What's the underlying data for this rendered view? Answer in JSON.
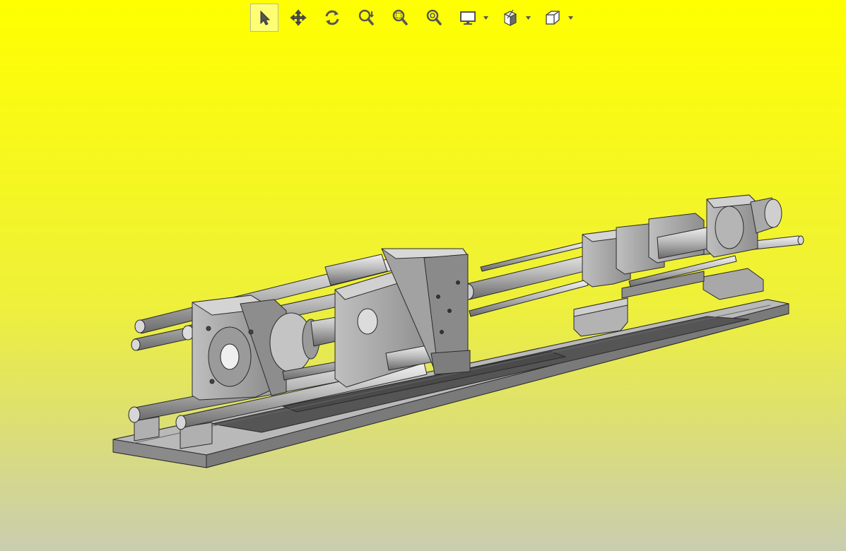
{
  "viewport": {
    "background_top": "#ffff00",
    "background_bottom": "#c9cdb0"
  },
  "toolbar": {
    "tools": [
      {
        "id": "select",
        "icon": "cursor-arrow-icon",
        "active": true
      },
      {
        "id": "pan",
        "icon": "pan-arrows-icon",
        "active": false
      },
      {
        "id": "rotate",
        "icon": "rotate-icon",
        "active": false
      },
      {
        "id": "zoom",
        "icon": "zoom-icon",
        "active": false
      },
      {
        "id": "zoom-window",
        "icon": "zoom-window-icon",
        "active": false
      },
      {
        "id": "zoom-fit",
        "icon": "zoom-fit-icon",
        "active": false
      },
      {
        "id": "display",
        "icon": "monitor-icon",
        "has_dropdown": true
      },
      {
        "id": "section",
        "icon": "section-cube-icon",
        "has_dropdown": true
      },
      {
        "id": "view-orientation",
        "icon": "cube-view-icon",
        "has_dropdown": true
      }
    ]
  },
  "model": {
    "part_fill": "#a6a6a6",
    "part_light": "#d2d2d2",
    "part_dark": "#6e6e6e",
    "edge_color": "#2a2a2a"
  }
}
